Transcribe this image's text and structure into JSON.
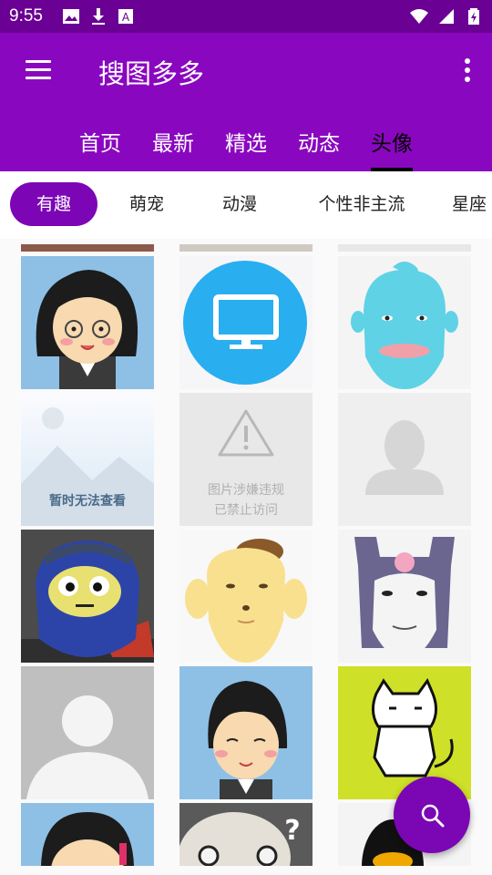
{
  "status": {
    "time": "9:55"
  },
  "app_bar": {
    "title": "搜图多多"
  },
  "tabs": [
    {
      "label": "首页"
    },
    {
      "label": "最新"
    },
    {
      "label": "精选"
    },
    {
      "label": "动态"
    },
    {
      "label": "头像",
      "selected": true
    }
  ],
  "chips": [
    {
      "label": "有趣",
      "selected": true
    },
    {
      "label": "萌宠"
    },
    {
      "label": "动漫"
    },
    {
      "label": "个性非主流"
    },
    {
      "label": "星座"
    }
  ],
  "grid": {
    "placeholder_unavailable": "暂时无法查看",
    "placeholder_blocked_line1": "图片涉嫌违规",
    "placeholder_blocked_line2": "已禁止访问"
  },
  "colors": {
    "status_bar": "#6a0094",
    "app_bar": "#8a07c0",
    "accent": "#7c05b5"
  },
  "fab": {
    "icon": "search-icon"
  }
}
